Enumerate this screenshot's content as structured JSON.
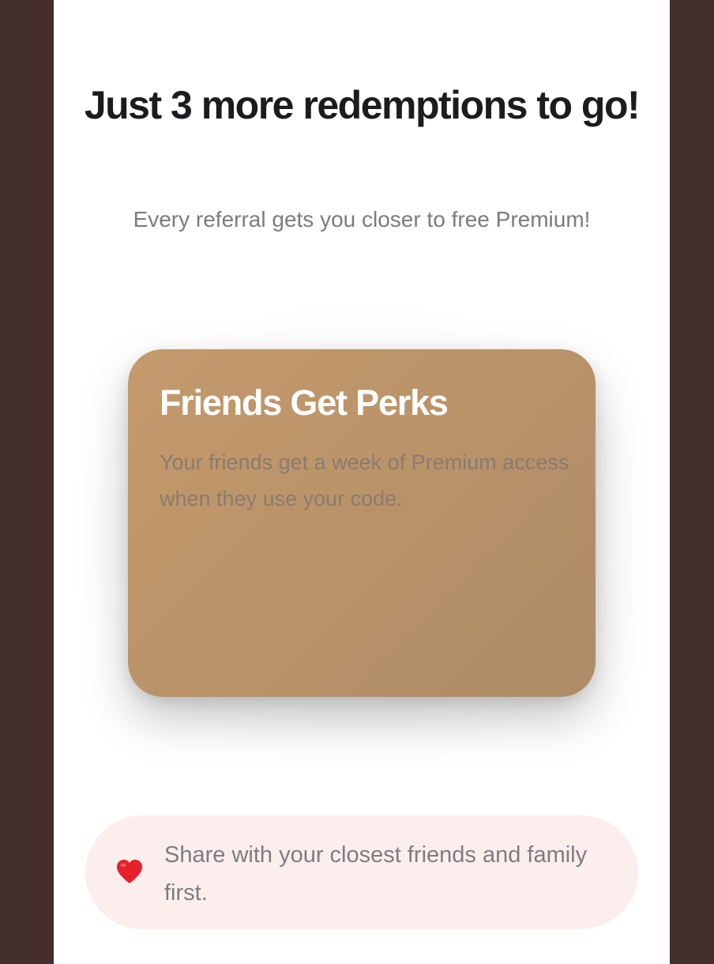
{
  "header": {
    "title": "Just 3 more redemptions to go!",
    "subtitle": "Every referral gets you closer to free Premium!"
  },
  "card": {
    "title": "Friends Get Perks",
    "body": "Your friends get a week of Premium access when they use your code."
  },
  "tip": {
    "icon": "heart-icon",
    "text": "Share with your closest friends and family first."
  },
  "colors": {
    "background": "#432d2d",
    "panel": "#ffffff",
    "card_start": "#c49a6c",
    "card_end": "#ad8c68",
    "tip_background": "#fdeeee",
    "heart": "#e8202a"
  }
}
